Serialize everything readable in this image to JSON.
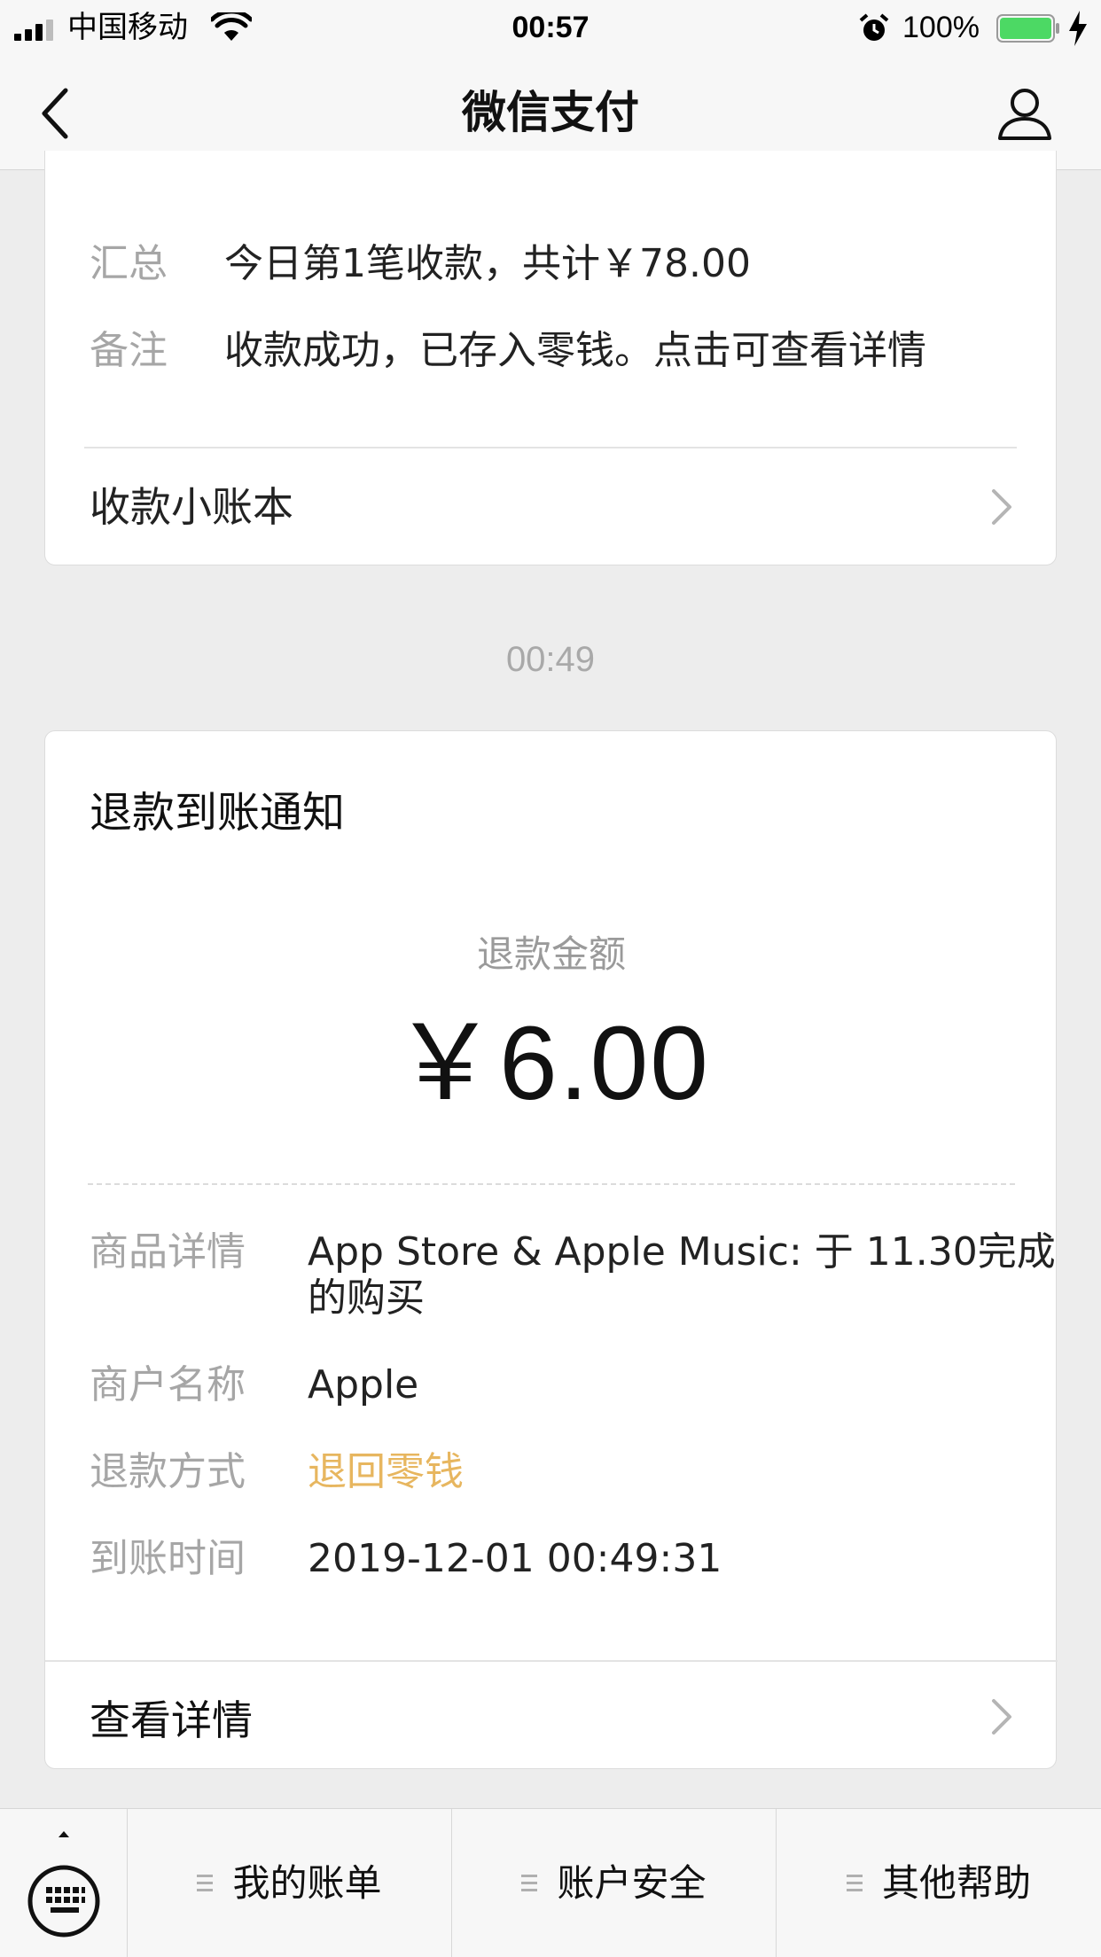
{
  "status_bar": {
    "carrier": "中国移动",
    "time": "00:57",
    "battery_percent": "100%",
    "battery_level": 1.0,
    "battery_color": "#4cd964"
  },
  "nav": {
    "title": "微信支付",
    "back_icon": "chevron-left-icon",
    "profile_icon": "person-icon"
  },
  "collection_card": {
    "summary_label": "汇总",
    "summary_value": "今日第1笔收款，共计￥78.00",
    "note_label": "备注",
    "note_value": "收款成功，已存入零钱。点击可查看详情",
    "ledger_link": "收款小账本"
  },
  "timestamp": "00:49",
  "refund_card": {
    "title": "退款到账通知",
    "amount_label": "退款金额",
    "amount": "￥6.00",
    "details": [
      {
        "label": "商品详情",
        "value_line1": "App Store & Apple Music: 于 11.30完成",
        "value_line2": "的购买"
      },
      {
        "label": "商户名称",
        "value": "Apple"
      },
      {
        "label": "退款方式",
        "value": "退回零钱"
      },
      {
        "label": "到账时间",
        "value": "2019-12-01 00:49:31"
      }
    ],
    "detail_link": "查看详情",
    "accent_color": "#e7b65f"
  },
  "toolbar": {
    "keyboard_icon": "keyboard-icon",
    "items": [
      {
        "label": "我的账单"
      },
      {
        "label": "账户安全"
      },
      {
        "label": "其他帮助"
      }
    ]
  }
}
